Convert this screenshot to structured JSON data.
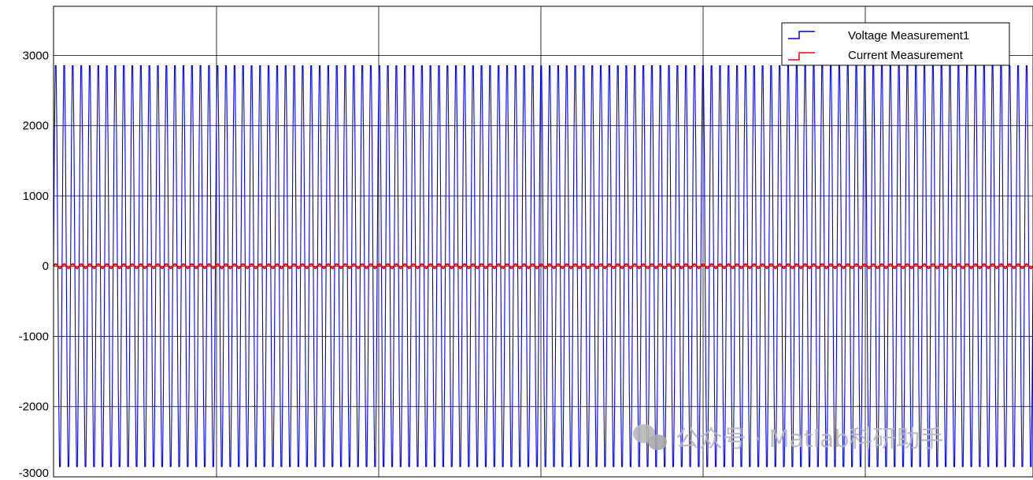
{
  "chart_data": {
    "type": "line",
    "title": "",
    "xlabel": "",
    "ylabel": "",
    "ylim": [
      -3000,
      3700
    ],
    "yticks": [
      3000,
      2000,
      1000,
      0,
      -1000,
      -2000,
      -3000
    ],
    "ytick_labels": [
      "3000",
      "2000",
      "1000",
      "0",
      "-1000",
      "-2000",
      "-3000"
    ],
    "grid": true,
    "legend_placement": "top-right",
    "series": [
      {
        "name": "Voltage Measurement1",
        "color": "#0000ff",
        "amplitude": 3000,
        "cycles": 115
      },
      {
        "name": "Current Measurement",
        "color": "#ff0000",
        "amplitude": 30,
        "cycles": 115
      }
    ]
  },
  "watermark": {
    "text": "公众号 · Matlab科研助手",
    "icon": "wechat-icon"
  }
}
